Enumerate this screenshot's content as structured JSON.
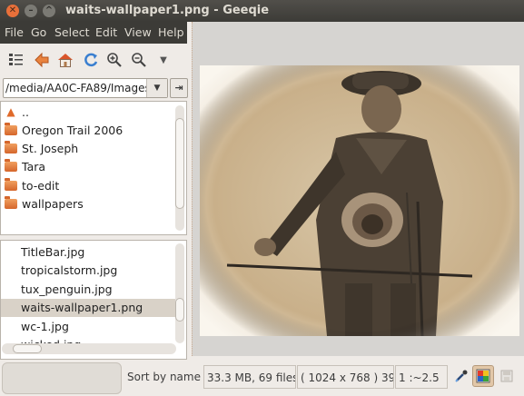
{
  "window": {
    "title": "waits-wallpaper1.png - Geeqie"
  },
  "menu": {
    "items": [
      "File",
      "Go",
      "Select",
      "Edit",
      "View",
      "Help"
    ]
  },
  "path": {
    "value": "/media/AA0C-FA89/Images"
  },
  "directories": [
    {
      "label": "..",
      "icon": "up-arrow-icon"
    },
    {
      "label": "Oregon Trail 2006",
      "icon": "folder-icon"
    },
    {
      "label": "St. Joseph",
      "icon": "folder-icon"
    },
    {
      "label": "Tara",
      "icon": "folder-icon"
    },
    {
      "label": "to-edit",
      "icon": "folder-icon"
    },
    {
      "label": "wallpapers",
      "icon": "folder-icon"
    }
  ],
  "files": [
    {
      "label": "TitleBar.jpg",
      "selected": false
    },
    {
      "label": "tropicalstorm.jpg",
      "selected": false
    },
    {
      "label": "tux_penguin.jpg",
      "selected": false
    },
    {
      "label": "waits-wallpaper1.png",
      "selected": true
    },
    {
      "label": "wc-1.jpg",
      "selected": false
    },
    {
      "label": "wicked.jpg",
      "selected": false
    }
  ],
  "status": {
    "sort": "Sort by name",
    "size_info": "33.3 MB, 69 files",
    "dims": "( 1024 x 768 ) 39",
    "zoom": "1 :~2.5"
  },
  "colors": {
    "title_bg": "#3c3b37",
    "accent": "#e9703a",
    "selection": "#d9d2c8"
  }
}
